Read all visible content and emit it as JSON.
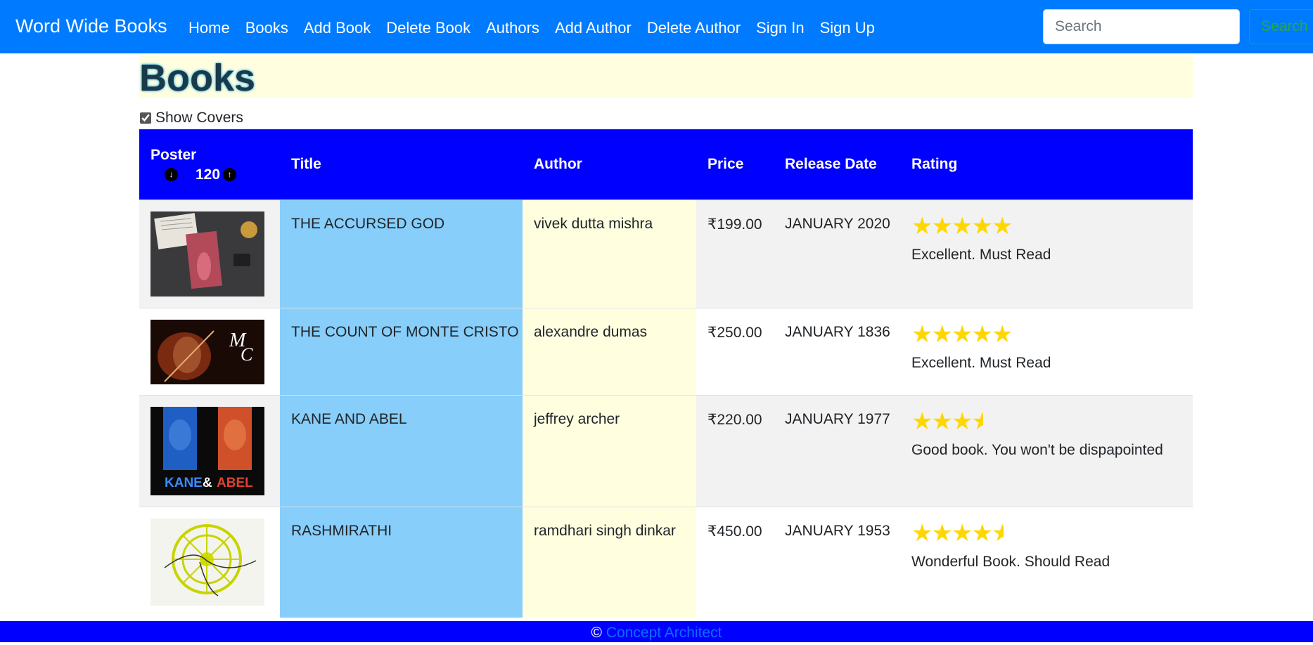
{
  "navbar": {
    "brand": "Word Wide Books",
    "links": [
      "Home",
      "Books",
      "Add Book",
      "Delete Book",
      "Authors",
      "Add Author",
      "Delete Author",
      "Sign In",
      "Sign Up"
    ],
    "search_placeholder": "Search",
    "search_button": "Search"
  },
  "page": {
    "title": "Books",
    "show_covers_label": "Show Covers",
    "show_covers_checked": true
  },
  "table": {
    "headers": {
      "poster": "Poster",
      "poster_size": "120",
      "title": "Title",
      "author": "Author",
      "price": "Price",
      "release_date": "Release Date",
      "rating": "Rating"
    },
    "rows": [
      {
        "title": "THE ACCURSED GOD",
        "author": "vivek dutta mishra",
        "price": "₹199.00",
        "release_date": "JANUARY 2020",
        "rating": 5,
        "rating_text": "Excellent. Must Read"
      },
      {
        "title": "THE COUNT OF MONTE CRISTO",
        "author": "alexandre dumas",
        "price": "₹250.00",
        "release_date": "JANUARY 1836",
        "rating": 5,
        "rating_text": "Excellent. Must Read"
      },
      {
        "title": "KANE AND ABEL",
        "author": "jeffrey archer",
        "price": "₹220.00",
        "release_date": "JANUARY 1977",
        "rating": 3.5,
        "rating_text": "Good book. You won't be dispapointed"
      },
      {
        "title": "RASHMIRATHI",
        "author": "ramdhari singh dinkar",
        "price": "₹450.00",
        "release_date": "JANUARY 1953",
        "rating": 4.5,
        "rating_text": "Wonderful Book. Should Read"
      }
    ]
  },
  "footer": {
    "copyright_symbol": "©",
    "link": "Concept Architect"
  },
  "colors": {
    "navbar": "#007bff",
    "table_header": "#0000ff",
    "title_col": "#87cefa",
    "author_col": "#ffffe0",
    "stars": "#ffd700"
  }
}
